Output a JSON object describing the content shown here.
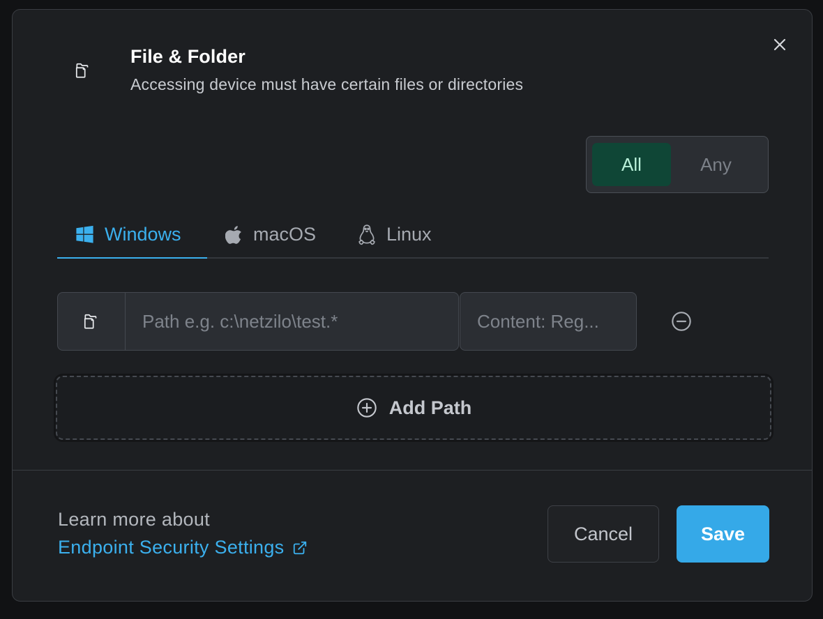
{
  "dialog": {
    "title": "File & Folder",
    "subtitle": "Accessing device must have certain files or directories",
    "header_icon": "files-icon",
    "close_icon": "close-icon"
  },
  "match_toggle": {
    "options": [
      "All",
      "Any"
    ],
    "selected": "All"
  },
  "tabs": [
    {
      "label": "Windows",
      "icon": "windows-icon",
      "active": true
    },
    {
      "label": "macOS",
      "icon": "apple-icon",
      "active": false
    },
    {
      "label": "Linux",
      "icon": "linux-icon",
      "active": false
    }
  ],
  "path_entry": {
    "path_value": "",
    "path_placeholder": "Path e.g. c:\\netzilo\\test.*",
    "content_value": "",
    "content_placeholder": "Content: Reg..."
  },
  "add_path": {
    "label": "Add Path",
    "icon": "plus-circle-icon"
  },
  "footer": {
    "learn_more": "Learn more about",
    "link_label": "Endpoint Security Settings",
    "cancel_label": "Cancel",
    "save_label": "Save"
  },
  "colors": {
    "accent": "#3bb0ee",
    "save_bg": "#35a9e8",
    "toggle_active_bg": "#0f4636",
    "toggle_active_text": "#b9f0d9",
    "panel_bg": "#1d1f22"
  }
}
